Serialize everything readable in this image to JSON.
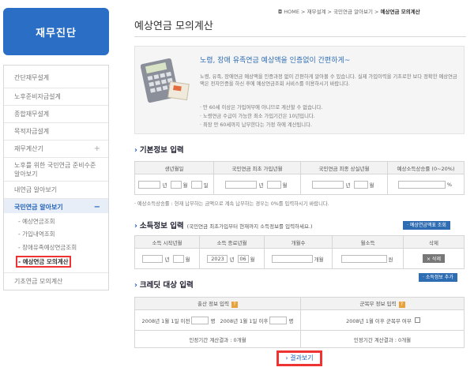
{
  "sidebar": {
    "logo": "재무진단",
    "items": [
      {
        "label": "간단재무설계"
      },
      {
        "label": "노후준비자금설계"
      },
      {
        "label": "종합재무설계"
      },
      {
        "label": "목적자금설계"
      },
      {
        "label": "재무계산기"
      },
      {
        "label": "노후를 위한 국민연금 준비수준 알아보기"
      },
      {
        "label": "내연금 알아보기"
      },
      {
        "label": "국민연금 알아보기"
      }
    ],
    "subitems": [
      {
        "label": "- 예상연금조회"
      },
      {
        "label": "- 가입내역조회"
      },
      {
        "label": "- 장애유족예상연금조회"
      },
      {
        "label": "- 예상연금 모의계산"
      }
    ],
    "bottom": "기초연금 모의계산",
    "plus": "+",
    "minus": "−"
  },
  "breadcrumb": {
    "home": "HOME",
    "l1": "재무설계",
    "l2": "국민연금 알아보기",
    "current": "예상연금 모의계산"
  },
  "page_title": "예상연금 모의계산",
  "info": {
    "headline": "노령, 장애 유족연금 예상액을 인증없이 간편하게~",
    "desc": "노령, 유족, 장애연금 예상액을 인증과정 없이 간편하게 알아볼 수 있습니다. 실제 가입이력을 기초로한 보다 정확한 예상연금액은 전자인증을 하신 후에 예상연금조회 서비스를 이용하시기 바랍니다.",
    "bullets": [
      "· 만 60세 이상은 가입여부에 아니므로 계산할 수 없습니다.",
      "· 노령연금 수급이 가능한 최소 가입기간은 10년입니다.",
      "· 최장 만 60세까지 납부한다는 가정 하에 계산됩니다."
    ]
  },
  "basic": {
    "title": "기본정보 입력",
    "headers": [
      "생년월일",
      "국민연금 최초 가입년월",
      "국민연금 최종 상실년월",
      "예상소득상승률 (0~20%)"
    ],
    "unit_year": "년",
    "unit_month": "월",
    "unit_day": "일",
    "unit_pct": "%",
    "note": "· 예상소득상승률 : 현재 납부하는 금액으로 계속 납부하는 경우는 0%를 입력하시기 바랍니다."
  },
  "income": {
    "title": "소득정보 입력",
    "subtitle": "(국민연금 최초가입부터 현재까지 소득정보를 입력하세요.)",
    "btn_avg": "· 예상연금액표 조회",
    "headers": [
      "소득 시작년월",
      "소득 종료년월",
      "개월수",
      "월소득",
      "삭제"
    ],
    "end_year": "2023",
    "end_month": "06",
    "unit_year": "년",
    "unit_month": "월",
    "unit_months": "개월",
    "unit_won": "원",
    "delete": "× 삭제",
    "btn_add": "· 소득정보 추가"
  },
  "credit": {
    "title": "크레딧 대상 입력",
    "left_header": "출산 정보 입력",
    "right_header": "군복무 정보 입력",
    "help": "?",
    "birth_before": "2008년 1월 1일 이전",
    "birth_after": "2008년 1월 1일 이후",
    "unit_person": "명",
    "military_text": "2008년 1월 이후 군복무 여부",
    "left_result": "인정기간 계산결과 : 0개월",
    "right_result": "인정기간 계산결과 : 0개월"
  },
  "result_button": "› 결과보기",
  "colors": {
    "brand": "#2a6fc5",
    "highlight": "#e33333"
  }
}
